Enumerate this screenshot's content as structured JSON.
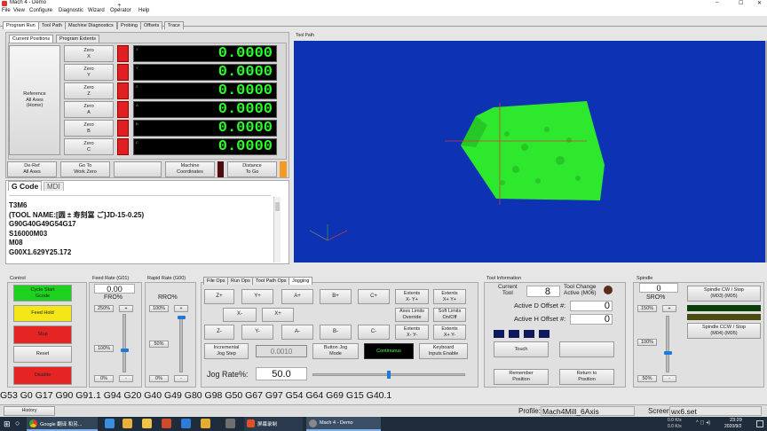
{
  "window": {
    "title": "Mach 4 - Demo",
    "min": "–",
    "max": "☐",
    "close": "✕"
  },
  "menu": [
    "File",
    "View",
    "Configure",
    "Diagnostic",
    "Wizard",
    "Operator",
    "Help"
  ],
  "main_tabs": [
    "Program Run",
    "Tool Path",
    "Machine Diagnostics",
    "Probing",
    "Offsets",
    "Trace"
  ],
  "position_tabs": [
    "Current Positions",
    "Program Extents"
  ],
  "reference_all": "Reference\nAll Axes\n(Home)",
  "axes": [
    {
      "zero": "Zero\nX",
      "tag": "X",
      "value": "0.0000"
    },
    {
      "zero": "Zero\nY",
      "tag": "Y",
      "value": "0.0000"
    },
    {
      "zero": "Zero\nZ",
      "tag": "Z",
      "value": "0.0000"
    },
    {
      "zero": "Zero\nA",
      "tag": "A",
      "value": "0.0000"
    },
    {
      "zero": "Zero\nB",
      "tag": "B",
      "value": "0.0000"
    },
    {
      "zero": "Zero\nC",
      "tag": "C",
      "value": "0.0000"
    }
  ],
  "dro_buttons": {
    "dereft": "De-Ref\nAll Axes",
    "gotozero": "Go To\nWork Zero",
    "machine_coords": "Machine\nCoordinates",
    "dist_to_go": "Distance\nTo Go"
  },
  "gcode_tabs": [
    "G Code",
    "MDI"
  ],
  "gcode_lines": [
    "T3M6",
    "(TOOL NAME:[圆 ± 寿刻冨 ご]JD-15-0.25)",
    "G90G40G49G54G17",
    "S16000M03",
    "M08",
    "G00X1.629Y25.172"
  ],
  "toolpath_label": "Tool Path",
  "control": {
    "title": "Control",
    "cycle_start": "Cycle Start\nGcode",
    "feed_hold": "Feed Hold",
    "stop": "Stop",
    "reset": "Reset",
    "disable": "Disable"
  },
  "feed_rate": {
    "title": "Feed Rate (G01)",
    "value": "0.00",
    "label": "FRO%",
    "preset_top": "250%",
    "preset_mid": "100%",
    "preset_bottom": "0%",
    "minus": "-",
    "plus": "+",
    "level": 0.4
  },
  "rapid_rate": {
    "title": "Rapid Rate (G00)",
    "label": "RRO%",
    "preset_top": "100%",
    "preset_mid": "50%",
    "preset_bottom": "0%",
    "minus": "-",
    "plus": "+",
    "level": 1.0
  },
  "jog": {
    "tabs": [
      "File Ops",
      "Run Ops",
      "Tool Path Ops",
      "Jogging"
    ],
    "buttons": [
      "Z+",
      "Y+",
      "A+",
      "B+",
      "C+",
      "X-",
      "X+",
      "Z-",
      "Y-",
      "A-",
      "B-",
      "C-"
    ],
    "extents1": "Extents\nX- Y+",
    "extents2": "Extents\nX+ Y+",
    "axes_limits": "Axes Limits\nOverride",
    "soft_limits": "Soft Limits\nOn/Off",
    "extents3": "Extents\nX- Y-",
    "extents4": "Extents\nX+ Y-",
    "incremental": "Incremental\nJog Step",
    "step_value": "0.0010",
    "button_jog": "Button Jog\nMode",
    "continuous": "Continuous",
    "keyboard": "Keyboard\nInputs Enable",
    "rate_label": "Jog Rate%:",
    "rate_value": "50.0",
    "rate_level": 0.5
  },
  "tool": {
    "title": "Tool Information",
    "current_label": "Current\nTool",
    "current_value": "8",
    "change_label": "Tool Change\nActive (M06)",
    "d_label": "Active D Offset #:",
    "d_value": "0",
    "h_label": "Active H Offset #:",
    "h_value": "0",
    "touch": "Touch",
    "remember": "Remember\nPosition",
    "return": "Return to\nPosition"
  },
  "spindle": {
    "title": "Spindle",
    "value": "0",
    "label": "SRO%",
    "preset_top": "150%",
    "preset_mid": "100%",
    "preset_bottom": "50%",
    "minus": "-",
    "plus": "+",
    "cw": "Spindle CW / Stop\n(M03)          (M05)",
    "ccw": "Spindle CCW / Stop\n(M04)          (M05)",
    "level": 0.35
  },
  "gcode_status": "G53 G0 G17 G90 G91.1 G94 G20 G40 G49 G80 G98 G50 G67 G97 G54 G64 G69 G15 G40.1",
  "status": {
    "history": "History",
    "profile_label": "Profile:",
    "profile_value": "Mach4Mill_6Axis",
    "screen_label": "Screen",
    "screen_value": "wx6.set"
  },
  "taskbar": {
    "browser_label": "Google 翻译 和另...",
    "mach_label": "Mach 4 - Demo",
    "red_label": "屏幕录制",
    "net_up": "0.0 K/s",
    "net_down": "0.0 K/s",
    "time": "23:29",
    "date": "2020/9/2"
  },
  "colors": {
    "dro_green": "#2aff2a",
    "toolpath_bg": "#0d32b3",
    "part": "#2ee82e",
    "cycle_start": "#1fd11f",
    "feed_hold": "#f5e61a",
    "stop": "#e52424"
  }
}
